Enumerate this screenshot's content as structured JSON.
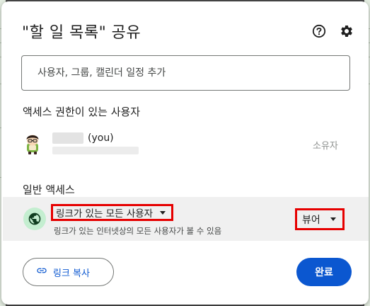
{
  "dialog": {
    "title": "\"할 일 목록\" 공유",
    "help_icon": "help-circle-icon",
    "settings_icon": "gear-icon"
  },
  "search": {
    "placeholder": "사용자, 그룹, 캘린더 일정 추가"
  },
  "people_with_access": {
    "label": "액세스 권한이 있는 사용자",
    "users": [
      {
        "name_suffix": "(you)",
        "role": "소유자",
        "avatar_icon": "avatar-icon"
      }
    ]
  },
  "general_access": {
    "label": "일반 액세스",
    "icon": "globe-icon",
    "scope_selected": "링크가 있는 모든 사용자",
    "description": "링크가 있는 인터넷상의 모든 사용자가 볼 수 있음",
    "role_selected": "뷰어",
    "accent_color": "#e60000",
    "icon_bg_color": "#c4eed0"
  },
  "footer": {
    "copy_link_label": "링크 복사",
    "copy_link_icon": "link-icon",
    "done_label": "완료",
    "primary_color": "#0b57d0"
  }
}
